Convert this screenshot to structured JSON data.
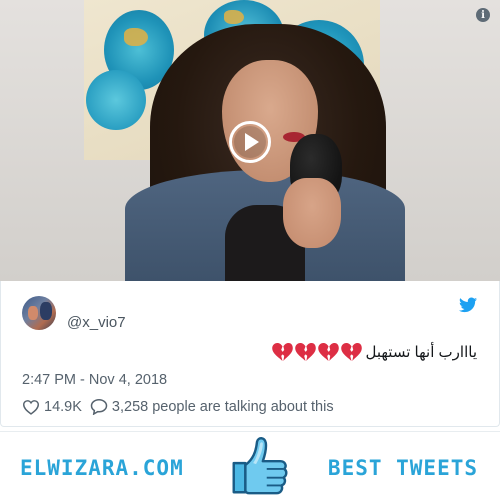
{
  "video": {
    "info_label": "i"
  },
  "tweet": {
    "handle": "@x_vio7",
    "text": "يااارب أنها تستهبل",
    "emoji": [
      "💔",
      "💔",
      "💔",
      "💔"
    ],
    "timestamp": "2:47 PM - Nov 4, 2018",
    "likes": "14.9K",
    "talking": "3,258 people are talking about this"
  },
  "banner": {
    "left_text": "ELWIZARA.COM",
    "right_text": "BEST TWEETS"
  },
  "colors": {
    "twitter_blue": "#1da1f2",
    "brand_blue": "#2aa4d8",
    "heart_red": "#dd2e44",
    "muted_text": "#56626d"
  },
  "icons": {
    "video": [
      "play-icon",
      "info-icon"
    ],
    "tweet": [
      "twitter-bird-icon",
      "broken-heart-icon",
      "heart-outline-icon",
      "speech-bubble-icon"
    ],
    "banner": [
      "thumbs-up-icon"
    ]
  }
}
